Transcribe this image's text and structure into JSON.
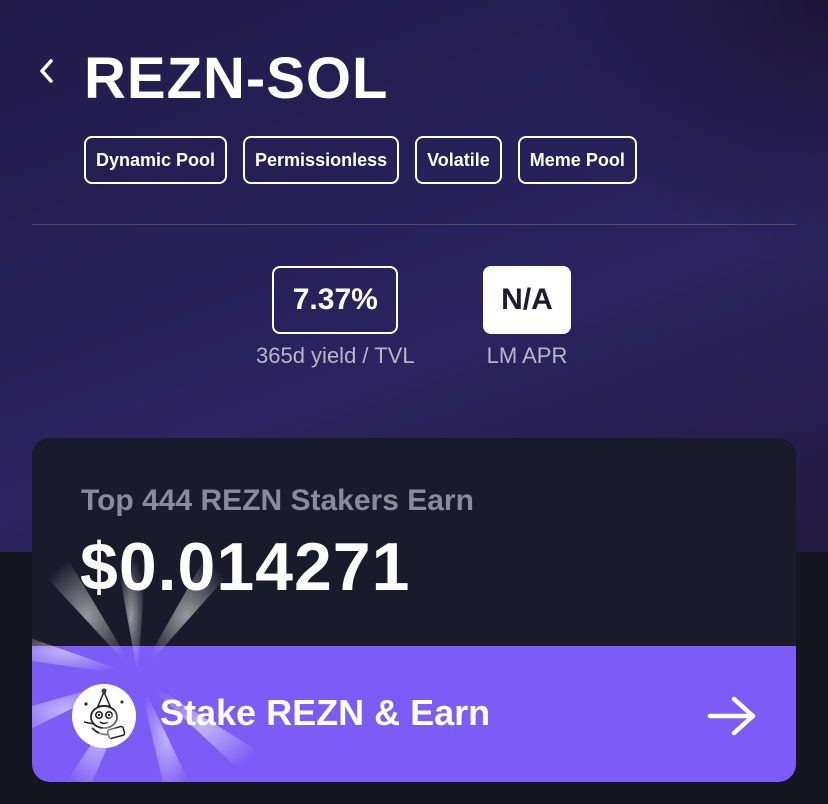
{
  "header": {
    "title": "REZN-SOL",
    "back_icon": "chevron-left-icon"
  },
  "tags": [
    "Dynamic Pool",
    "Permissionless",
    "Volatile",
    "Meme Pool"
  ],
  "stats": {
    "yield": {
      "value": "7.37%",
      "label": "365d yield / TVL"
    },
    "lm_apr": {
      "value": "N/A",
      "label": "LM APR"
    }
  },
  "stake_card": {
    "heading": "Top 444 REZN Stakers Earn",
    "amount": "$0.014271",
    "cta_label": "Stake REZN & Earn",
    "cta_icon": "arrow-right-icon",
    "avatar_icon": "rezn-mascot-icon",
    "accent": "#7b5cf6"
  },
  "colors": {
    "background_top": "#271f57",
    "background_bottom": "#15151f",
    "card": "#1b1a2a"
  }
}
